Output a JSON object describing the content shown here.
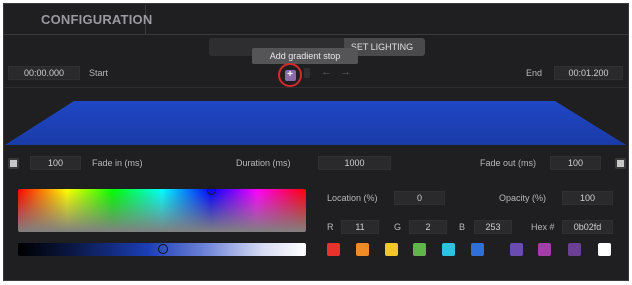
{
  "header": {
    "title": "CONFIGURATION"
  },
  "toolbar": {
    "set_lighting_label": "SET LIGHTING"
  },
  "tooltip": {
    "text": "Add gradient stop"
  },
  "timeline": {
    "start_value": "00:00.000",
    "start_label": "Start",
    "end_label": "End",
    "end_value": "00:01.200",
    "add_icon": "plus-square-icon",
    "nav_icons": [
      "arrow-left-icon",
      "arrow-right-icon"
    ]
  },
  "gradient_color": "#1a3fb5",
  "timing": {
    "fade_in_value": "100",
    "fade_in_label": "Fade in (ms)",
    "duration_label": "Duration (ms)",
    "duration_value": "1000",
    "fade_out_label": "Fade out (ms)",
    "fade_out_value": "100"
  },
  "stop": {
    "location_label": "Location (%)",
    "location_value": "0",
    "opacity_label": "Opacity (%)",
    "opacity_value": "100",
    "r_label": "R",
    "r_value": "11",
    "g_label": "G",
    "g_value": "2",
    "b_label": "B",
    "b_value": "253",
    "hex_label": "Hex #",
    "hex_value": "0b02fd"
  },
  "swatches": [
    "#e8322c",
    "#f08c28",
    "#f0c828",
    "#5fb54a",
    "#2ec1e0",
    "#2f6fd8",
    "#6a4cb0",
    "#a33ea8",
    "#6a3f94",
    "#ffffff"
  ]
}
